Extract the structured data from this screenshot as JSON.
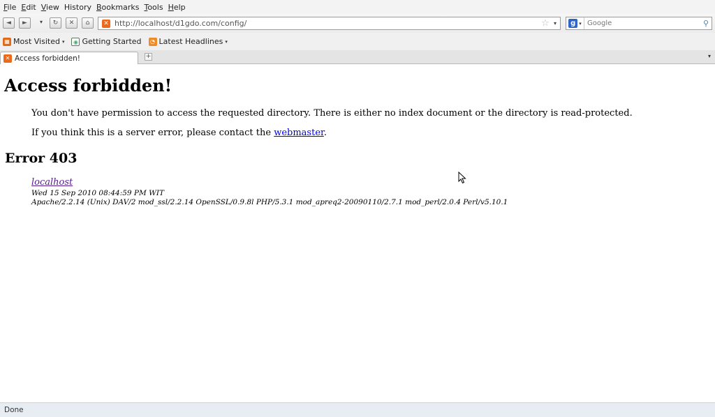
{
  "menubar": {
    "items": [
      {
        "label": "File",
        "u": "F",
        "rest": "ile"
      },
      {
        "label": "Edit",
        "u": "E",
        "rest": "dit"
      },
      {
        "label": "View",
        "u": "V",
        "rest": "iew"
      },
      {
        "label": "History",
        "u": "",
        "rest": "History"
      },
      {
        "label": "Bookmarks",
        "u": "B",
        "rest": "ookmarks"
      },
      {
        "label": "Tools",
        "u": "T",
        "rest": "ools"
      },
      {
        "label": "Help",
        "u": "H",
        "rest": "elp"
      }
    ]
  },
  "toolbar": {
    "back_icon": "◄",
    "forward_icon": "►",
    "history_dropdown_icon": "▾",
    "reload_icon": "↻",
    "stop_icon": "✕",
    "home_icon": "⌂",
    "url": "http://localhost/d1gdo.com/config/",
    "star_icon": "☆",
    "url_dropdown_icon": "▾",
    "search_engine_icon": "g",
    "search_placeholder": "Google",
    "search_icon": "🔍"
  },
  "bookmarks": {
    "items": [
      {
        "label": "Most Visited",
        "has_dropdown": true
      },
      {
        "label": "Getting Started",
        "has_dropdown": false
      },
      {
        "label": "Latest Headlines",
        "has_dropdown": true
      }
    ]
  },
  "tabs": {
    "active_title": "Access forbidden!",
    "new_tab_icon": "+",
    "list_icon": "▾"
  },
  "page": {
    "heading": "Access forbidden!",
    "message1": "You don't have permission to access the requested directory. There is either no index document or the directory is read-protected.",
    "message2_prefix": "If you think this is a server error, please contact the ",
    "message2_link": "webmaster",
    "message2_suffix": ".",
    "error_heading": "Error 403",
    "server_link": "localhost",
    "timestamp": "Wed 15 Sep 2010 08:44:59 PM WIT",
    "server_signature": "Apache/2.2.14 (Unix) DAV/2 mod_ssl/2.2.14 OpenSSL/0.9.8l PHP/5.3.1 mod_apreq2-20090110/2.7.1 mod_perl/2.0.4 Perl/v5.10.1"
  },
  "statusbar": {
    "text": "Done"
  }
}
